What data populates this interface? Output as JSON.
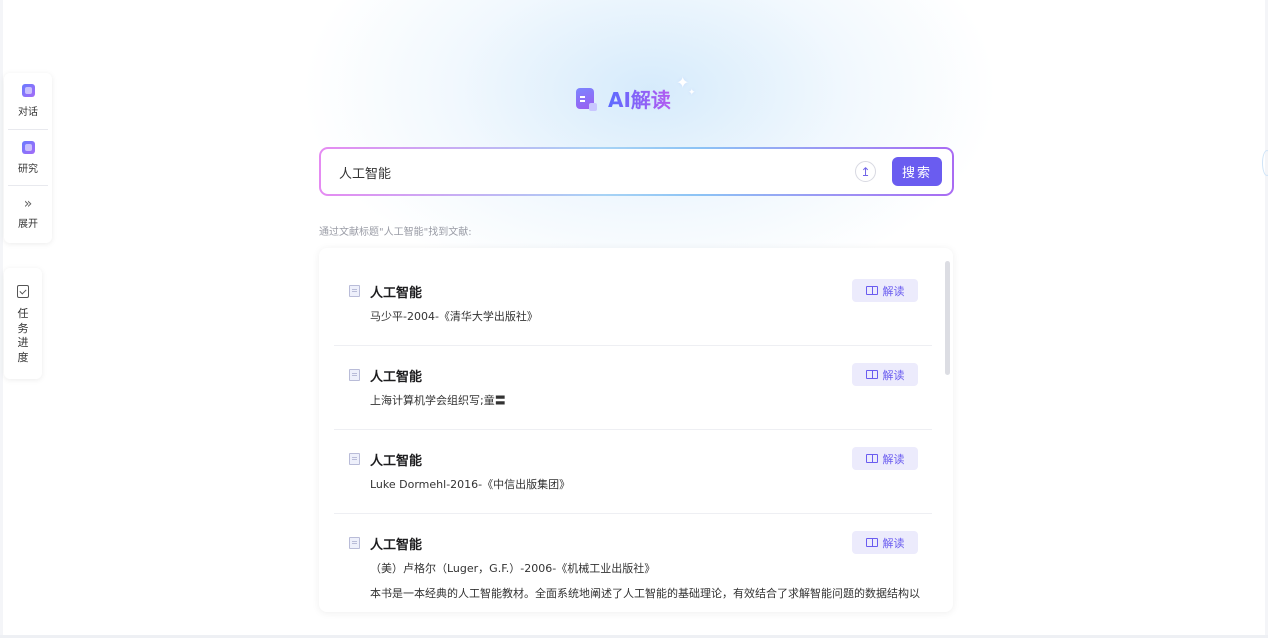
{
  "side_nav": {
    "items": [
      {
        "label": "对话"
      },
      {
        "label": "研究"
      },
      {
        "label": "展开",
        "icon": "»"
      }
    ]
  },
  "task_panel": {
    "label": "任务进度"
  },
  "brand": {
    "title": "AI解读"
  },
  "search": {
    "value": "人工智能",
    "upload_icon": "↥",
    "button_label": "搜索"
  },
  "result_hint": "通过文献标题\"人工智能\"找到文献:",
  "results": [
    {
      "title": "人工智能",
      "meta": "马少平-2004-《清华大学出版社》",
      "desc": "",
      "button": "解读"
    },
    {
      "title": "人工智能",
      "meta": "上海计算机学会组织写;童〓",
      "desc": "",
      "button": "解读"
    },
    {
      "title": "人工智能",
      "meta": "Luke Dormehl-2016-《中信出版集团》",
      "desc": "",
      "button": "解读"
    },
    {
      "title": "人工智能",
      "meta": "（美）卢格尔（Luger，G.F.）-2006-《机械工业出版社》",
      "desc": "本书是一本经典的人工智能教材。全面系统地阐述了人工智能的基础理论，有效结合了求解智能问题的数据结构以",
      "button": "解读"
    }
  ],
  "colors": {
    "accent": "#6a5cf0",
    "accent_light": "#ecebfc",
    "brand_gradient_start": "#5d6bff",
    "brand_gradient_end": "#b45af0"
  }
}
